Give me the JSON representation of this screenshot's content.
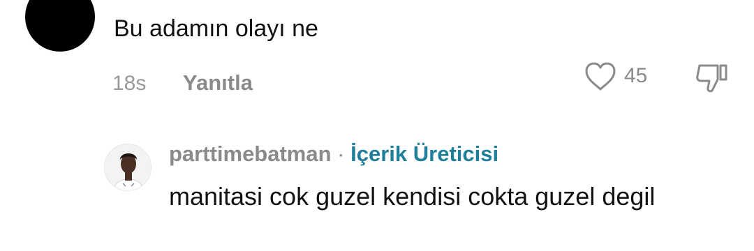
{
  "comment": {
    "text": "Bu adamın olayı ne",
    "time": "18s",
    "reply_label": "Yanıtla",
    "like_count": "45",
    "icons": {
      "like": "heart-outline-icon",
      "dislike": "thumbs-down-icon"
    }
  },
  "reply": {
    "username": "parttimebatman",
    "separator": "·",
    "badge": "İçerik Üreticisi",
    "text": "manitasi cok guzel kendisi cokta guzel degil"
  },
  "colors": {
    "text_primary": "#111111",
    "text_secondary": "#8a8a8a",
    "creator_badge": "#1f7f9a"
  }
}
